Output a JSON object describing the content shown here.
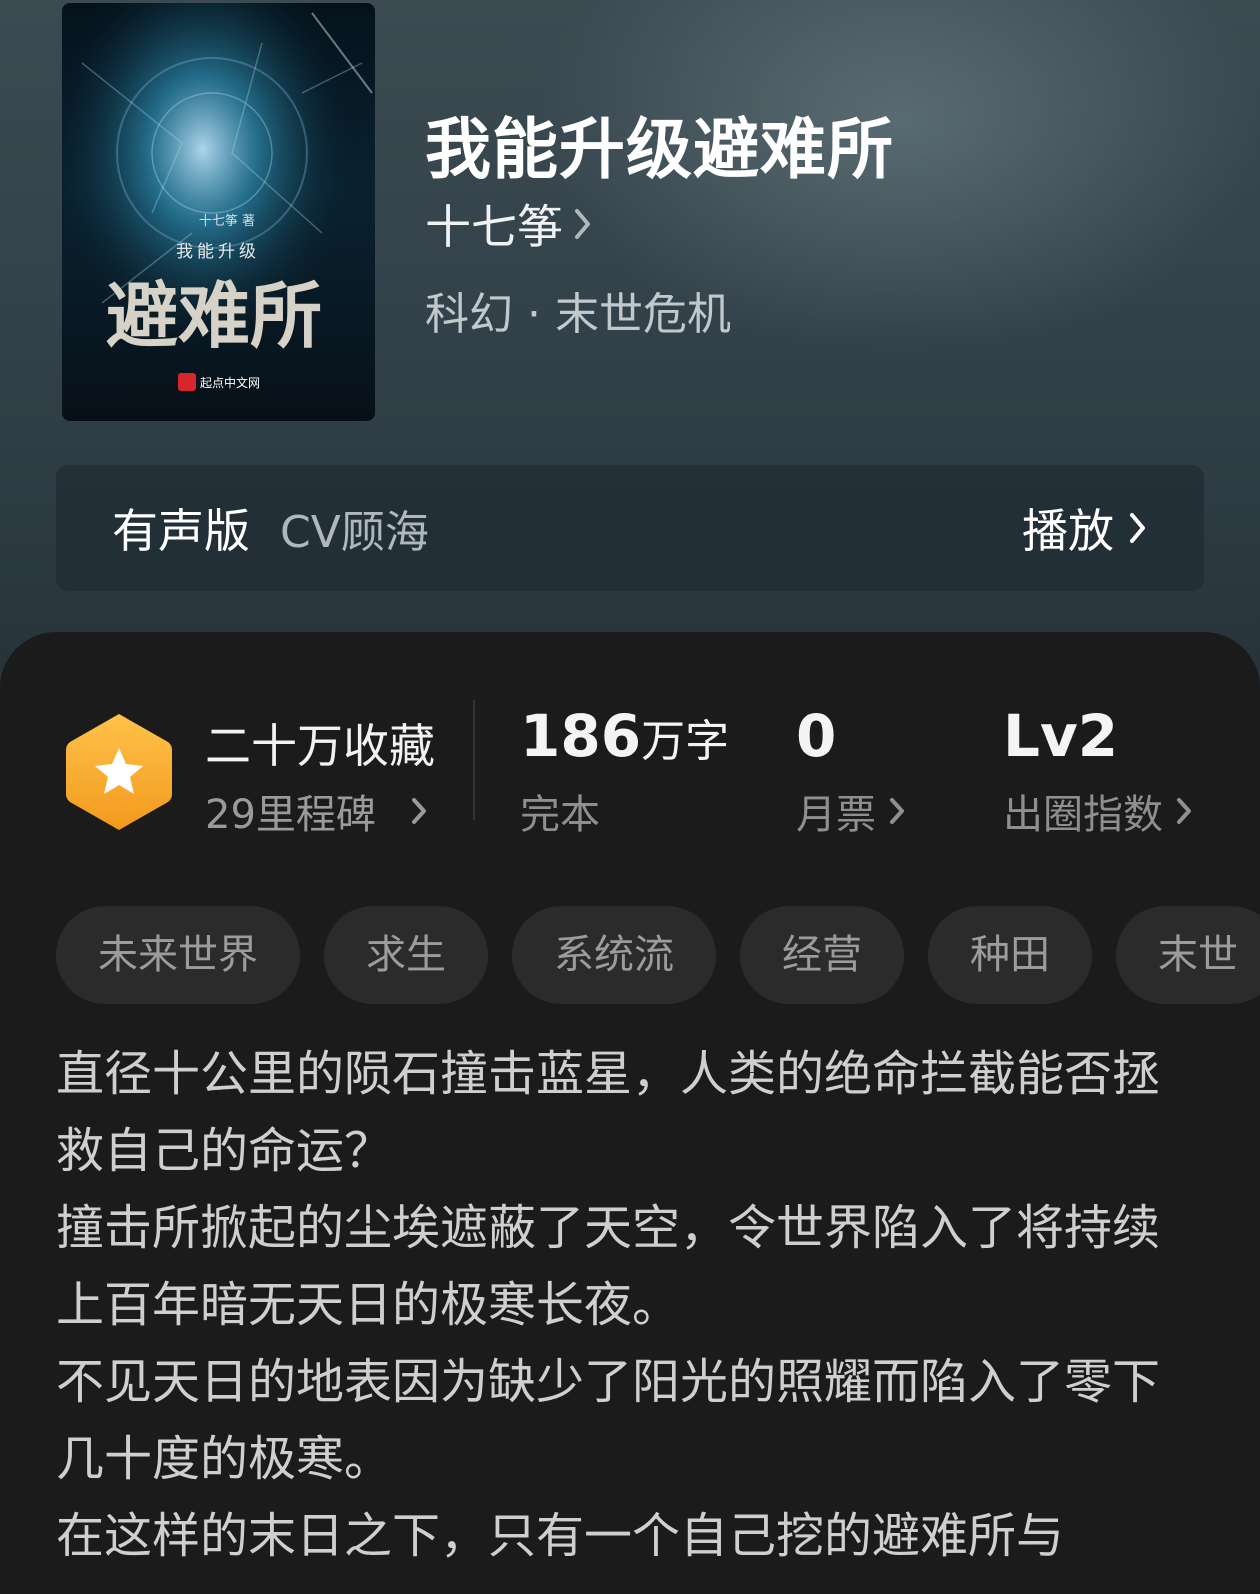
{
  "book": {
    "title": "我能升级避难所",
    "author": "十七筝",
    "genre": "科幻 · 末世危机",
    "cover": {
      "title_small": "我能升级",
      "title_large": "避难所",
      "author_tag": "十七筝 著",
      "publisher": "起点中文网"
    }
  },
  "audio": {
    "label": "有声版",
    "narrator": "CV顾海",
    "play_label": "播放"
  },
  "stats": {
    "collect": {
      "main": "二十万收藏",
      "sub": "29里程碑"
    },
    "words": {
      "value": "186",
      "unit": "万字",
      "label": "完本"
    },
    "monthly_ticket": {
      "value": "0",
      "label": "月票"
    },
    "breakout": {
      "value": "Lv2",
      "label": "出圈指数"
    }
  },
  "tags": [
    "未来世界",
    "求生",
    "系统流",
    "经营",
    "种田",
    "末世"
  ],
  "description": [
    "直径十公里的陨石撞击蓝星，人类的绝命拦截能否拯救自己的命运？",
    "撞击所掀起的尘埃遮蔽了天空，令世界陷入了将持续上百年暗无天日的极寒长夜。",
    "不见天日的地表因为缺少了阳光的照耀而陷入了零下几十度的极寒。",
    "在这样的末日之下，只有一个自己挖的避难所与"
  ],
  "colors": {
    "badge": "#f5a72b",
    "header_bg": "#34434b",
    "card_bg": "#1b1b1b"
  }
}
